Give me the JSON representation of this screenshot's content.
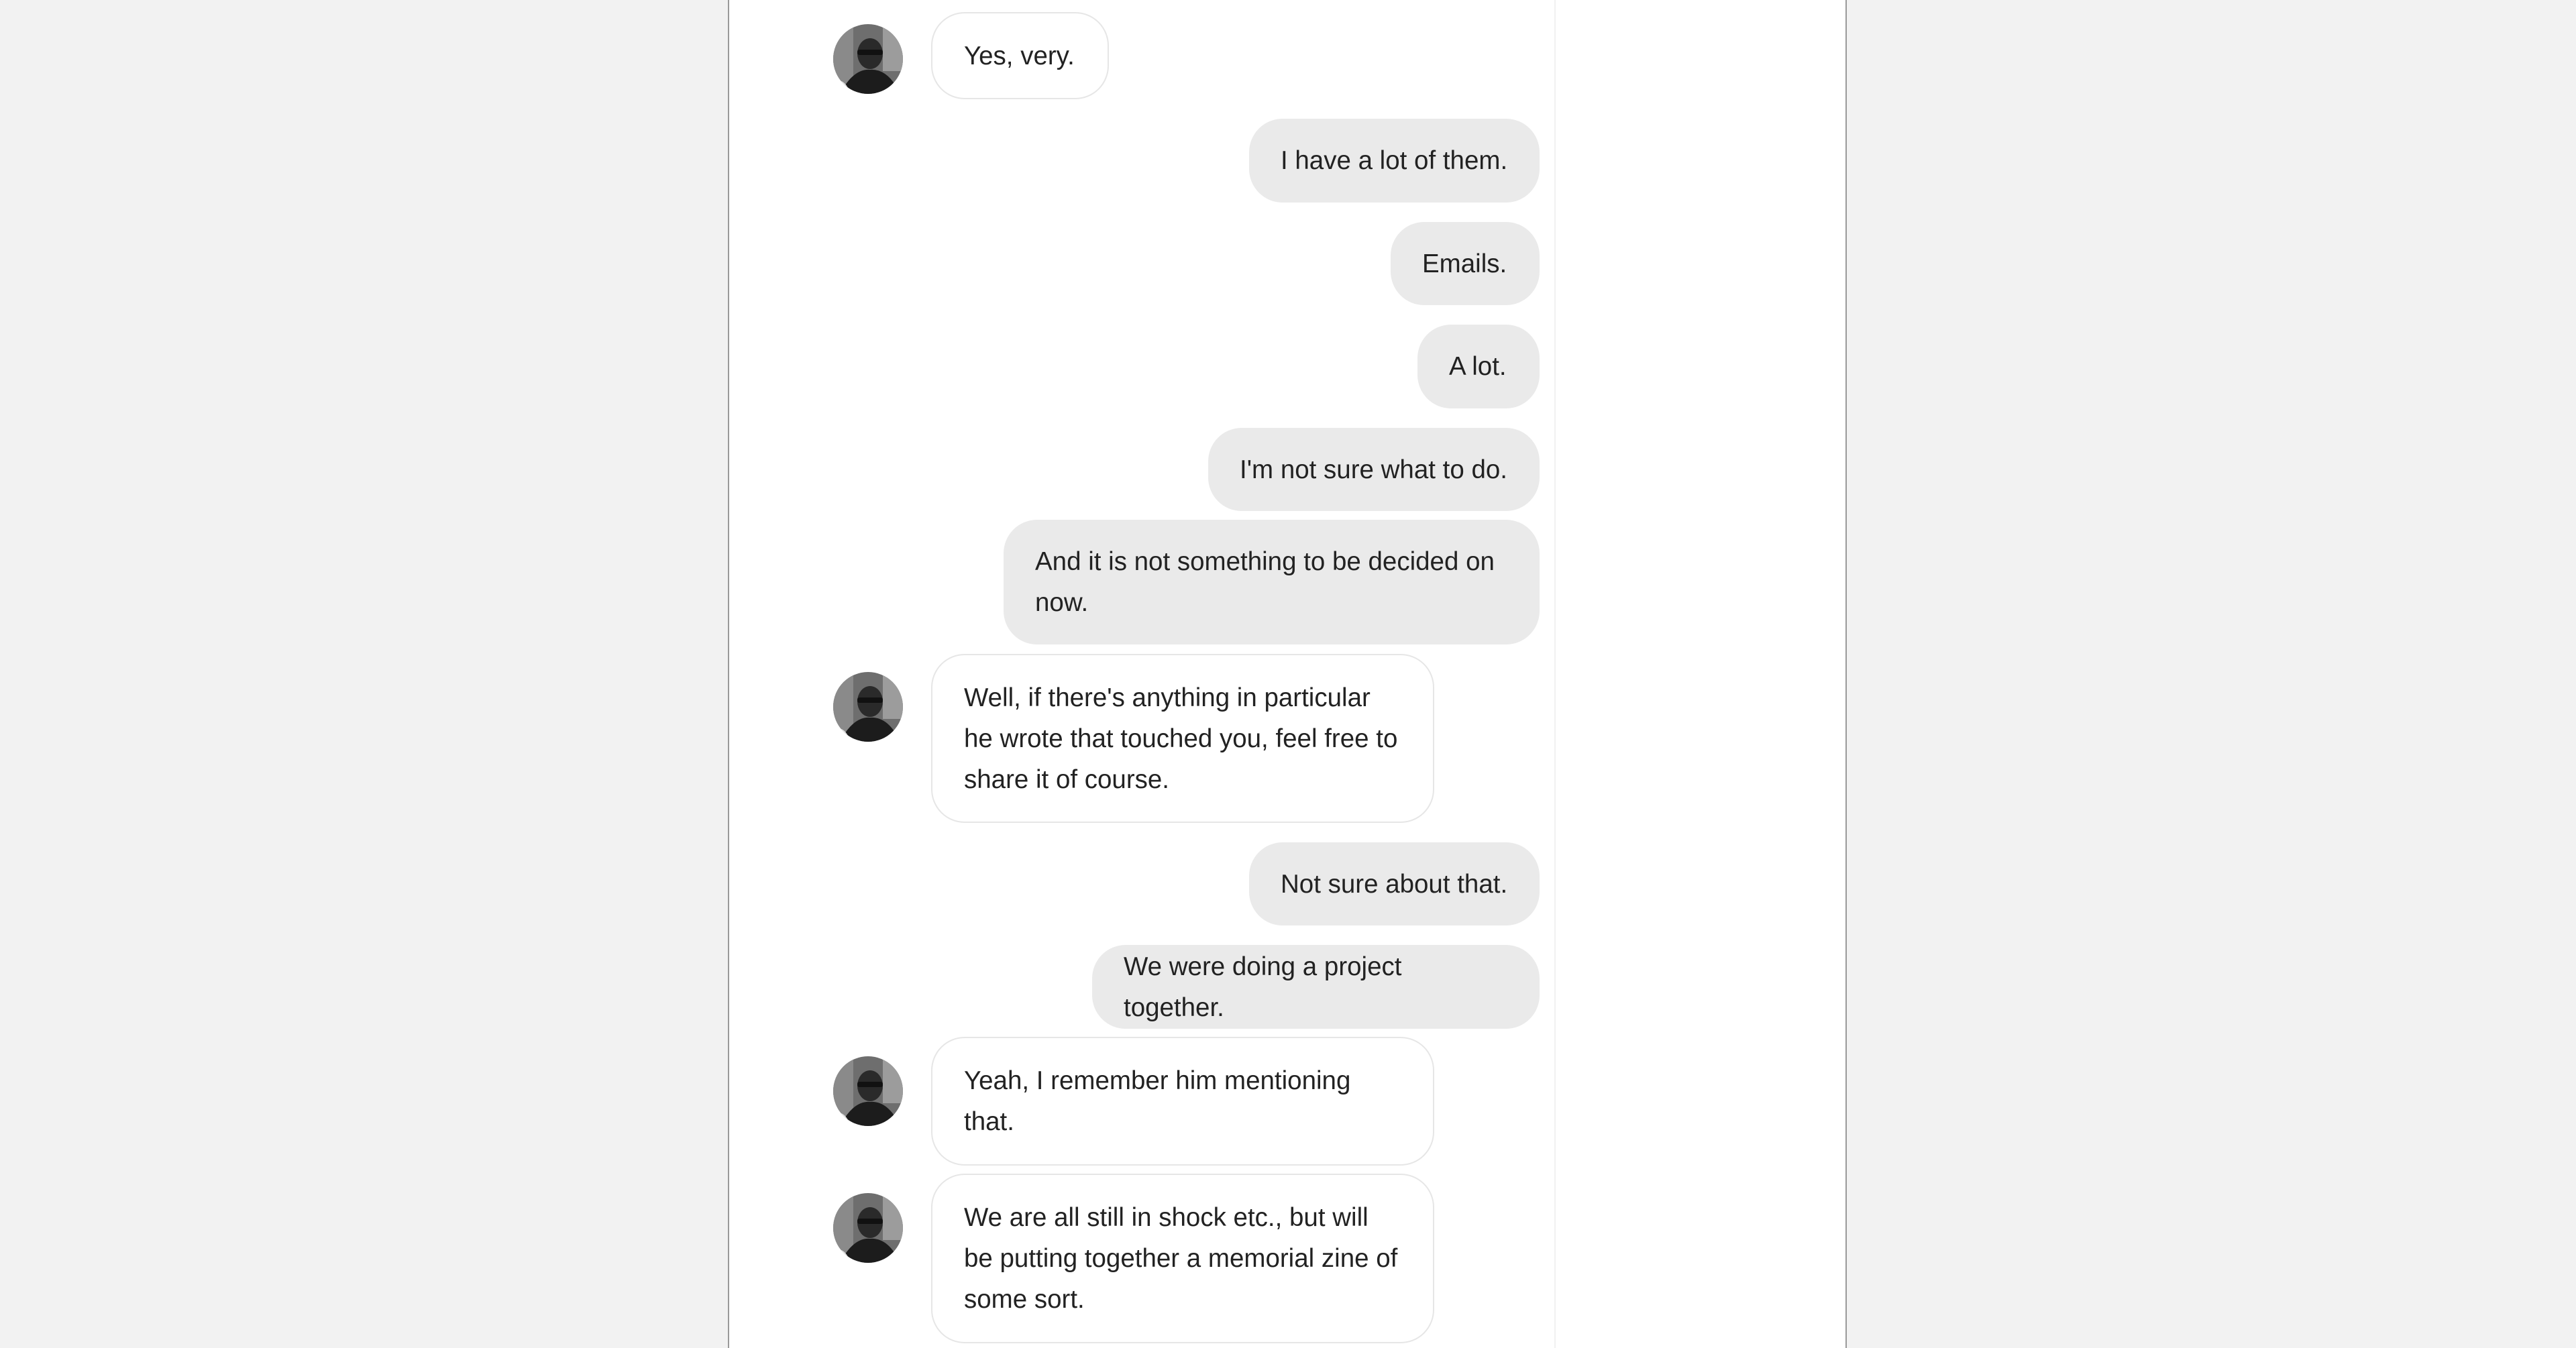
{
  "messages": [
    {
      "side": "in",
      "text": "Yes, very."
    },
    {
      "side": "out",
      "text": "I have a lot of them."
    },
    {
      "side": "out",
      "text": "Emails."
    },
    {
      "side": "out",
      "text": "A lot."
    },
    {
      "side": "out",
      "text": "I'm not sure what to do."
    },
    {
      "side": "out",
      "text": "And it is not something to be decided on now."
    },
    {
      "side": "in",
      "text": "Well, if there's anything in particular he wrote that touched you, feel free to share it of course."
    },
    {
      "side": "out",
      "text": "Not sure about that."
    },
    {
      "side": "out",
      "text": "We were doing a project together."
    },
    {
      "side": "in",
      "text": "Yeah, I remember him mentioning that."
    },
    {
      "side": "in",
      "text": "We are all still in shock etc., but will be putting together a memorial zine of some sort."
    }
  ],
  "avatar_icon": "person-photo-icon"
}
